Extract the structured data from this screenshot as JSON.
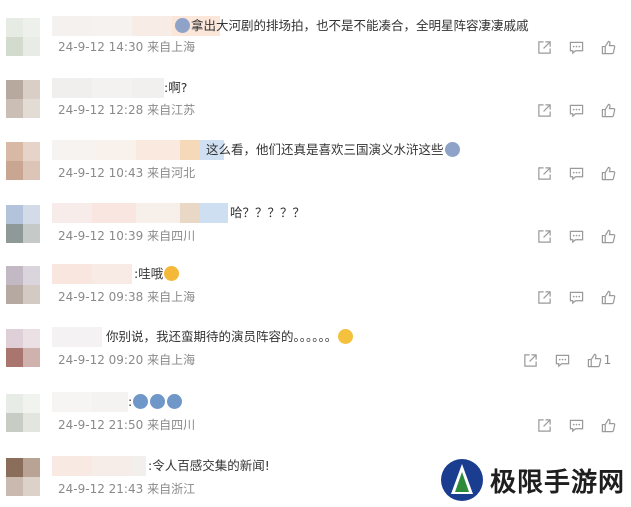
{
  "comments": [
    {
      "text": "拿出大河剧的排场拍，也不是不能凑合，全明星阵容凄凄戚戚",
      "date": "24-9-12 14:30",
      "location": "来自上海",
      "likes": ""
    },
    {
      "text": ":啊?",
      "date": "24-9-12 12:28",
      "location": "来自江苏",
      "likes": ""
    },
    {
      "text": "这么看，他们还真是喜欢三国演义水浒这些",
      "date": "24-9-12 10:43",
      "location": "来自河北",
      "likes": ""
    },
    {
      "text": "哈？？？？？",
      "date": "24-9-12 10:39",
      "location": "来自四川",
      "likes": ""
    },
    {
      "text": ":哇哦",
      "date": "24-9-12 09:38",
      "location": "来自上海",
      "likes": ""
    },
    {
      "text": "你别说，我还蛮期待的演员阵容的。。。。。。",
      "date": "24-9-12 09:20",
      "location": "来自上海",
      "likes": "1"
    },
    {
      "text": ":",
      "date": "24-9-12 21:50",
      "location": "来自四川",
      "likes": ""
    },
    {
      "text": ":令人百感交集的新闻!",
      "date": "24-9-12 21:43",
      "location": "来自浙江",
      "likes": ""
    }
  ],
  "icons": {
    "share": "share-icon",
    "comment": "comment-icon",
    "like": "thumbs-up-icon"
  },
  "watermark": {
    "text": "极限手游网"
  },
  "colors": {
    "meta": "#8a8a8a",
    "text": "#333333",
    "icon": "#9a9a9a"
  }
}
